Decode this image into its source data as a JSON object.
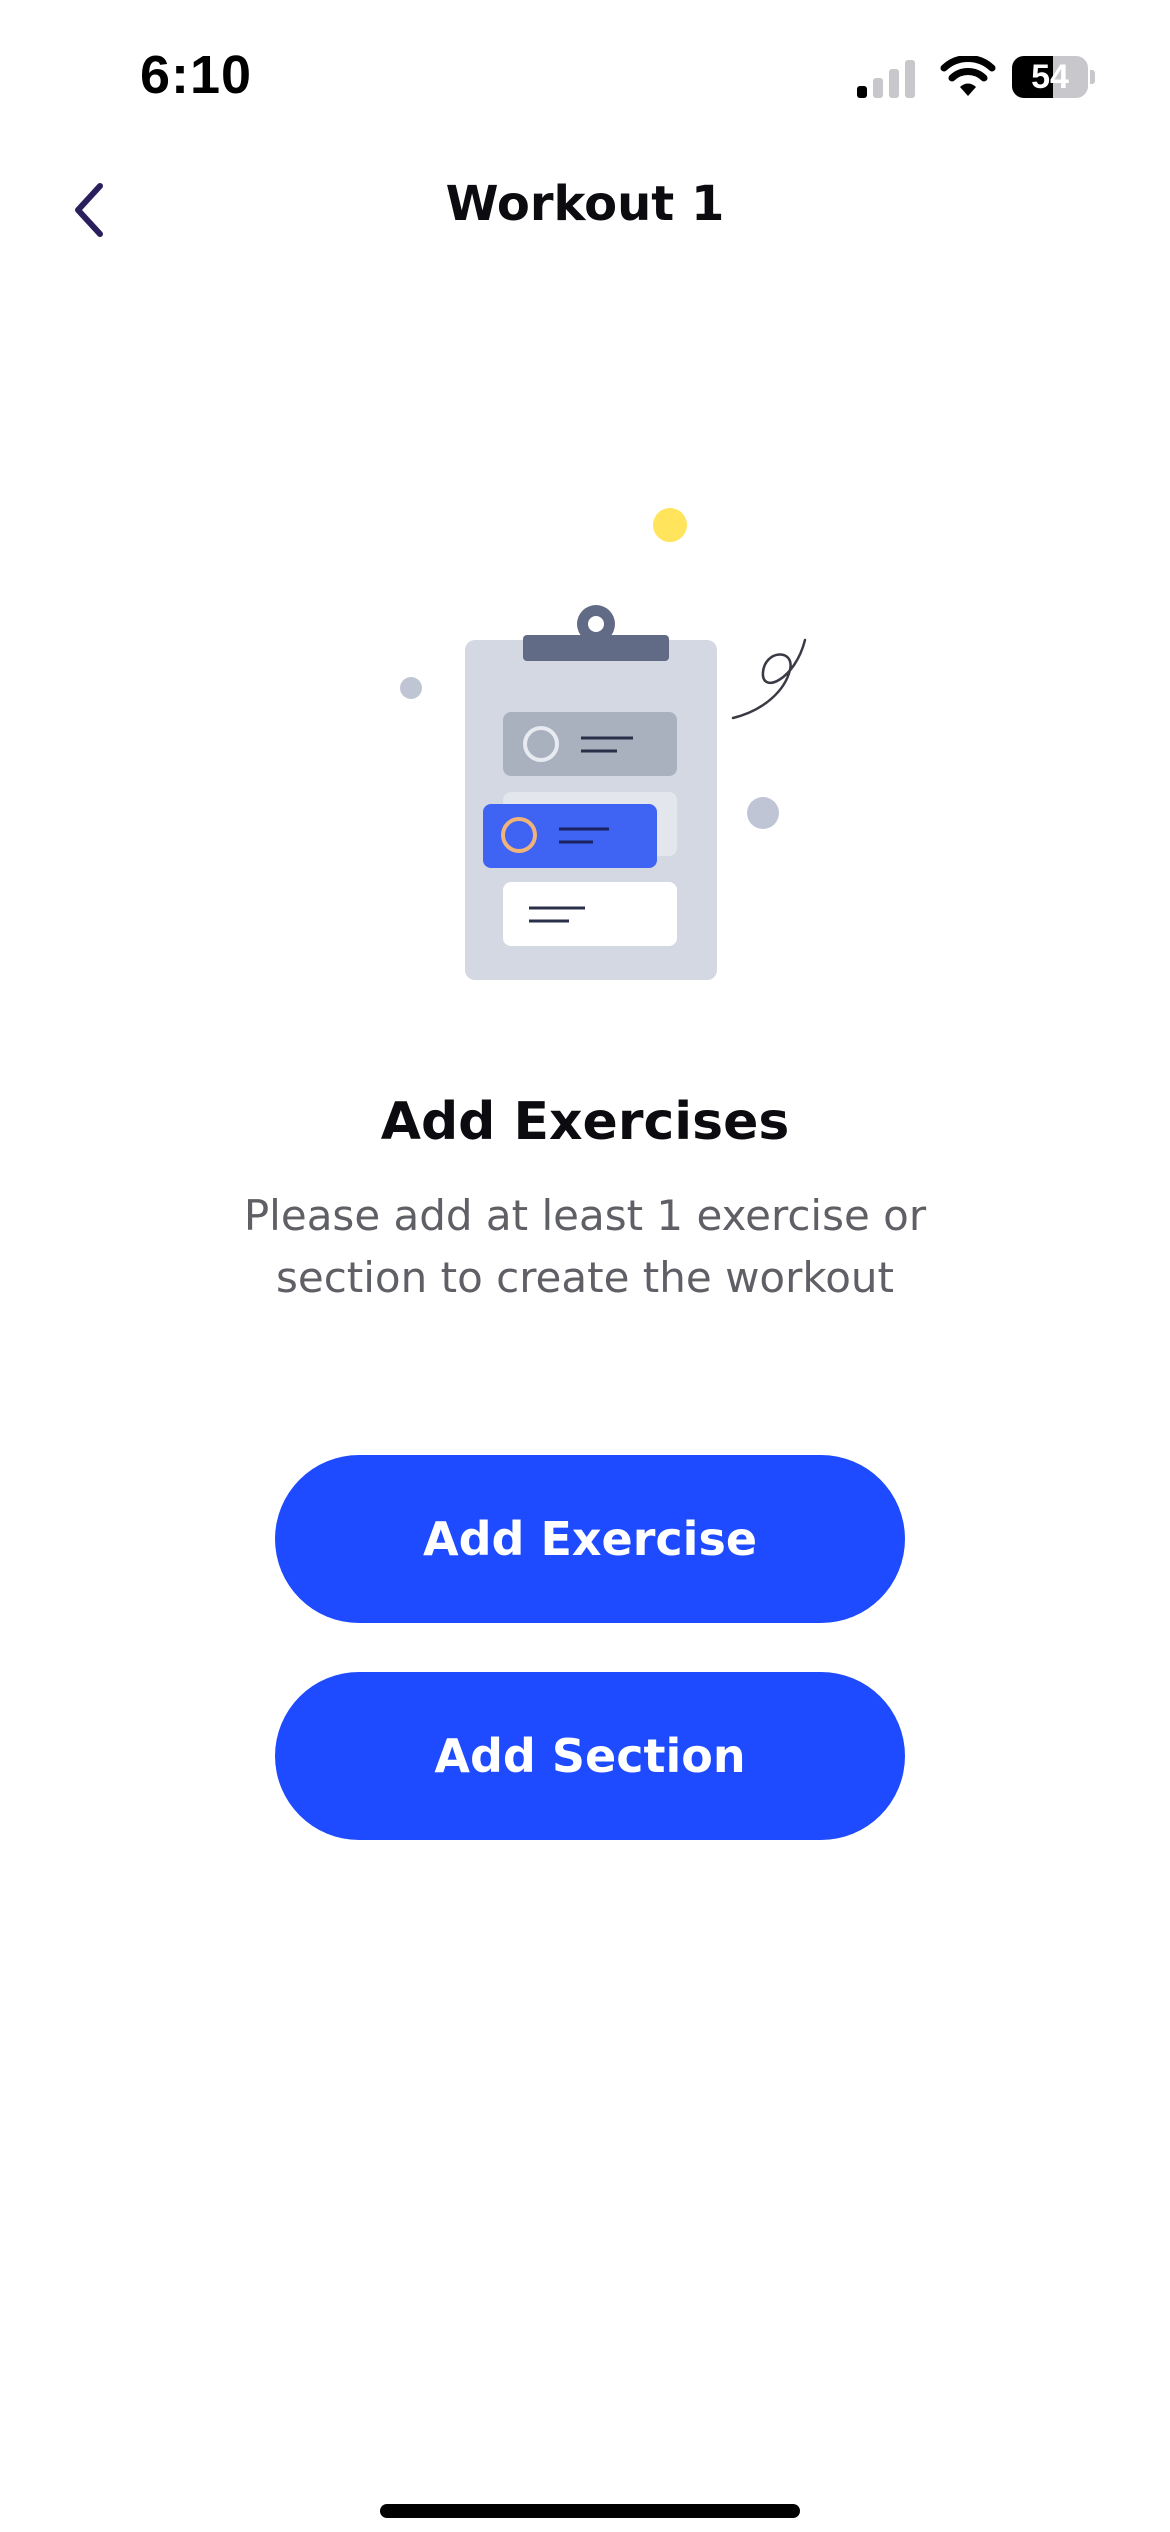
{
  "status_bar": {
    "time": "6:10",
    "battery_level": 54,
    "battery_label": "54",
    "icons": [
      "signal-icon",
      "wifi-icon",
      "battery-icon"
    ]
  },
  "nav": {
    "back_icon": "chevron-left-icon",
    "title": "Workout 1"
  },
  "empty_state": {
    "illustration": "clipboard-checklist-illustration",
    "title": "Add Exercises",
    "message": "Please add at least 1 exercise or section to create the workout"
  },
  "actions": {
    "add_exercise_label": "Add Exercise",
    "add_section_label": "Add Section"
  },
  "colors": {
    "primary": "#1E4BFF",
    "title_text": "#0B0B10",
    "secondary_text": "#5F5F66",
    "back_chevron": "#2A1E5C",
    "clipboard": "#D3D8E2",
    "accent_yellow": "#FFE45C"
  }
}
